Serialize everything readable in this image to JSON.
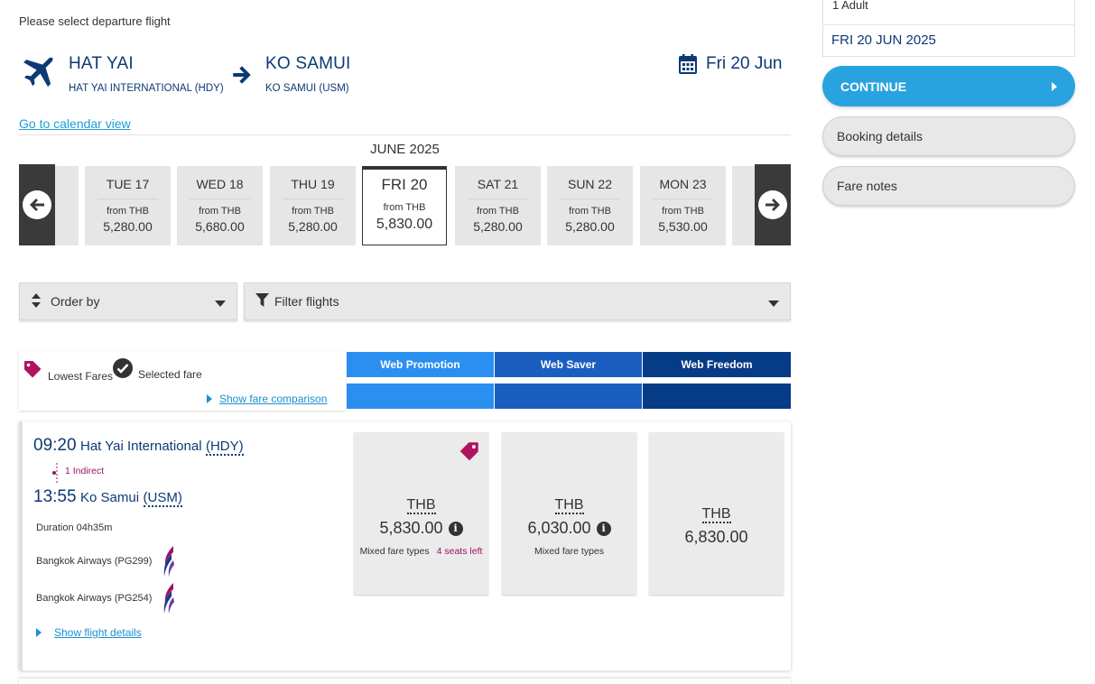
{
  "prompt": "Please select departure flight",
  "route": {
    "origin_city": "HAT YAI",
    "origin_airport": "HAT YAI INTERNATIONAL (HDY)",
    "dest_city": "KO SAMUI",
    "dest_airport": "KO SAMUI (USM)",
    "date": "Fri 20 Jun"
  },
  "calendar_link": "Go to calendar view",
  "month": "JUNE 2025",
  "days": [
    {
      "name": "TUE 17",
      "from": "from THB",
      "price": "5,280.00"
    },
    {
      "name": "WED 18",
      "from": "from THB",
      "price": "5,680.00"
    },
    {
      "name": "THU 19",
      "from": "from THB",
      "price": "5,280.00"
    },
    {
      "name": "FRI 20",
      "from": "from THB",
      "price": "5,830.00"
    },
    {
      "name": "SAT 21",
      "from": "from THB",
      "price": "5,280.00"
    },
    {
      "name": "SUN 22",
      "from": "from THB",
      "price": "5,280.00"
    },
    {
      "name": "MON 23",
      "from": "from THB",
      "price": "5,530.00"
    }
  ],
  "order_label": "Order by",
  "filter_label": "Filter flights",
  "legend": {
    "lowest": "Lowest Fares",
    "selected": "Selected fare",
    "compare": "Show fare comparison"
  },
  "fare_types": [
    {
      "name": "Web Promotion",
      "color": "#2b8fef",
      "bar": "#2b8fef"
    },
    {
      "name": "Web Saver",
      "color": "#1a5fc0",
      "bar": "#1a5fc0"
    },
    {
      "name": "Web Freedom",
      "color": "#063b86",
      "bar": "#063b86"
    }
  ],
  "flight": {
    "dep_time": "09:20",
    "dep_station": "Hat Yai International",
    "dep_code": "(HDY)",
    "stops": "1 Indirect",
    "arr_time": "13:55",
    "arr_station": "Ko Samui",
    "arr_code": "(USM)",
    "duration": "Duration 04h35m",
    "segments": [
      "Bangkok Airways (PG299)",
      "Bangkok Airways (PG254)"
    ],
    "details_link": "Show flight details",
    "fares": [
      {
        "currency": "THB",
        "amount": "5,830.00",
        "note": "Mixed fare types",
        "seats": "4 seats left"
      },
      {
        "currency": "THB",
        "amount": "6,030.00",
        "note": "Mixed fare types"
      },
      {
        "currency": "THB",
        "amount": "6,830.00"
      }
    ]
  },
  "sidebar": {
    "passengers": "1 Adult",
    "date": "FRI 20 JUN 2025",
    "continue": "CONTINUE",
    "booking_details": "Booking details",
    "fare_notes": "Fare notes"
  },
  "colors": {
    "navy": "#0c3a73",
    "accent": "#29a3df",
    "tag": "#b0135f"
  }
}
